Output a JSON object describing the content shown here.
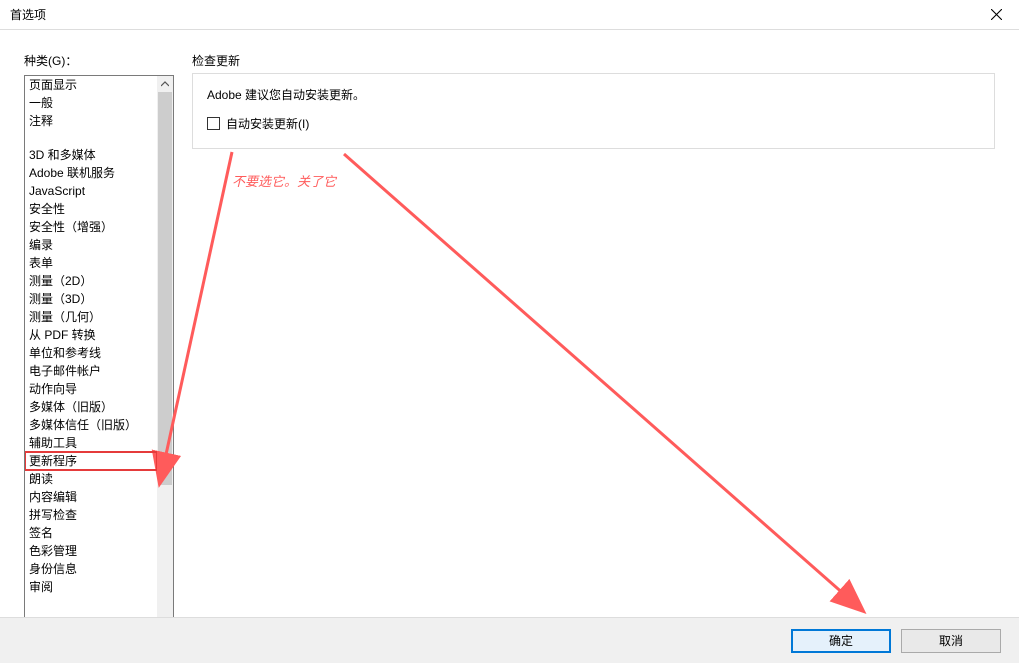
{
  "window": {
    "title": "首选项"
  },
  "sidebar": {
    "label": "种类(G)：",
    "items": [
      "页面显示",
      "一般",
      "注释",
      "",
      "3D 和多媒体",
      "Adobe 联机服务",
      "JavaScript",
      "安全性",
      "安全性（增强）",
      "编录",
      "表单",
      "测量（2D）",
      "测量（3D）",
      "测量（几何）",
      "从 PDF 转换",
      "单位和参考线",
      "电子邮件帐户",
      "动作向导",
      "多媒体（旧版）",
      "多媒体信任（旧版）",
      "辅助工具",
      "更新程序",
      "朗读",
      "内容编辑",
      "拼写检查",
      "签名",
      "色彩管理",
      "身份信息",
      "审阅"
    ],
    "highlighted_index": 21
  },
  "main": {
    "section_label": "检查更新",
    "description": "Adobe 建议您自动安装更新。",
    "checkbox_label": "自动安装更新(I)",
    "checkbox_checked": false
  },
  "annotation": {
    "text": "不要选它。关了它",
    "color": "#ff5b5b"
  },
  "footer": {
    "ok_label": "确定",
    "cancel_label": "取消"
  }
}
